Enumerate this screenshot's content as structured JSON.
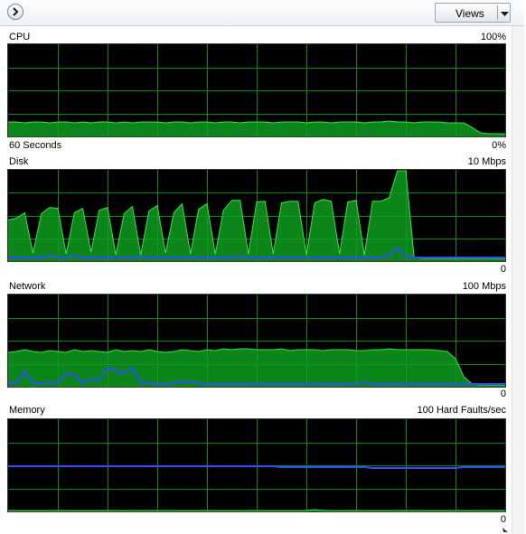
{
  "toolbar": {
    "views_label": "Views"
  },
  "colors": {
    "grid": "#008c1a",
    "fill": "#0e9d1f",
    "stroke": "#35e83a",
    "secondary": "#2f4fff",
    "background": "#000000"
  },
  "panels": {
    "cpu": {
      "title": "CPU",
      "max_label": "100%",
      "time_label": "60 Seconds",
      "min_label": "0%",
      "primary": [
        15,
        15,
        14,
        15,
        15,
        14,
        15,
        15,
        14,
        15,
        14,
        15,
        15,
        14,
        15,
        14,
        15,
        15,
        15,
        14,
        15,
        15,
        14,
        15,
        15,
        14,
        15,
        15,
        14,
        15,
        15,
        15,
        14,
        15,
        15,
        15,
        14,
        15,
        15,
        14,
        15,
        15,
        15,
        14,
        15,
        15,
        16,
        15,
        15,
        14,
        15,
        15,
        15,
        14,
        14,
        14,
        9,
        3,
        2,
        2,
        2
      ]
    },
    "disk": {
      "title": "Disk",
      "max_label": "10 Mbps",
      "min_label": "0",
      "primary": [
        45,
        47,
        53,
        8,
        52,
        59,
        58,
        7,
        53,
        58,
        9,
        56,
        59,
        6,
        52,
        60,
        6,
        55,
        61,
        8,
        53,
        63,
        7,
        57,
        63,
        7,
        56,
        67,
        67,
        7,
        65,
        66,
        7,
        64,
        66,
        66,
        6,
        64,
        68,
        66,
        7,
        65,
        67,
        6,
        66,
        66,
        70,
        100,
        100,
        3,
        2,
        2,
        2,
        2,
        2,
        2,
        2,
        2,
        2,
        2,
        2
      ],
      "secondary": [
        3,
        3,
        3,
        3,
        3,
        5,
        3,
        3,
        5,
        3,
        3,
        3,
        3,
        3,
        3,
        3,
        4,
        3,
        3,
        3,
        3,
        3,
        3,
        3,
        3,
        3,
        3,
        3,
        4,
        3,
        3,
        3,
        3,
        3,
        3,
        3,
        3,
        3,
        3,
        3,
        3,
        3,
        3,
        3,
        3,
        3,
        5,
        14,
        4,
        3,
        3,
        3,
        3,
        3,
        3,
        3,
        3,
        3,
        3,
        3,
        3
      ]
    },
    "network": {
      "title": "Network",
      "max_label": "100 Mbps",
      "min_label": "0",
      "primary": [
        37,
        38,
        40,
        38,
        37,
        39,
        38,
        37,
        40,
        38,
        39,
        38,
        37,
        40,
        38,
        39,
        38,
        40,
        38,
        37,
        38,
        40,
        39,
        38,
        40,
        39,
        41,
        40,
        41,
        41,
        40,
        40,
        40,
        41,
        39,
        40,
        40,
        40,
        39,
        40,
        40,
        40,
        39,
        39,
        40,
        40,
        41,
        40,
        40,
        40,
        40,
        40,
        39,
        38,
        30,
        10,
        2,
        1,
        1,
        1,
        1
      ],
      "secondary": [
        3,
        3,
        16,
        3,
        3,
        3,
        3,
        14,
        12,
        3,
        7,
        6,
        20,
        17,
        13,
        20,
        3,
        3,
        2,
        2,
        3,
        5,
        4,
        3,
        2,
        2,
        2,
        2,
        2,
        2,
        2,
        2,
        2,
        2,
        2,
        2,
        2,
        2,
        2,
        2,
        2,
        2,
        2,
        4,
        2,
        2,
        2,
        2,
        2,
        2,
        2,
        2,
        2,
        2,
        2,
        2,
        2,
        2,
        2,
        2,
        2
      ]
    },
    "memory": {
      "title": "Memory",
      "max_label": "100 Hard Faults/sec",
      "min_label": "0",
      "primary": [
        0,
        0,
        0,
        0,
        0,
        0,
        0,
        0,
        0,
        0,
        0,
        0,
        0,
        0,
        0,
        0,
        0,
        0,
        0,
        0,
        0,
        0,
        0,
        0,
        0,
        0,
        0,
        0,
        0,
        0,
        0,
        0,
        0,
        0,
        0,
        0,
        0,
        1,
        0,
        0,
        0,
        0,
        0,
        0,
        0,
        0,
        0,
        0,
        0,
        0,
        0,
        0,
        0,
        0,
        0,
        0,
        0,
        0,
        0,
        0,
        0
      ],
      "secondary": [
        49,
        49,
        49,
        49,
        49,
        49,
        49,
        49,
        49,
        49,
        49,
        49,
        49,
        49,
        49,
        49,
        49,
        49,
        49,
        49,
        49,
        49,
        49,
        49,
        49,
        49,
        49,
        49,
        49,
        49,
        49,
        49,
        49,
        48,
        48,
        48,
        48,
        48,
        48,
        48,
        48,
        48,
        48,
        48,
        47,
        47,
        47,
        47,
        47,
        47,
        47,
        47,
        47,
        47,
        47,
        48,
        48,
        48,
        48,
        48,
        48
      ]
    }
  }
}
